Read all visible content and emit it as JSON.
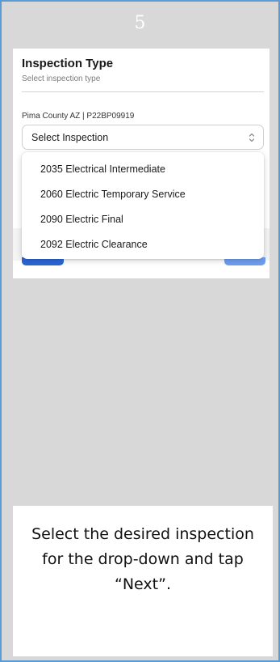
{
  "step": {
    "number": "5"
  },
  "form": {
    "title": "Inspection Type",
    "subtitle": "Select inspection type",
    "permit_label": "Pima County AZ | P22BP09919",
    "select": {
      "value": "Select Inspection",
      "icon": "chevron-up-down-icon"
    }
  },
  "dropdown": {
    "options": [
      "2035 Electrical Intermediate",
      "2060 Electric Temporary Service",
      "2090 Electric Final",
      "2092 Electric Clearance"
    ]
  },
  "instruction": {
    "text": "Select the desired inspection for the drop-down and tap “Next”."
  },
  "colors": {
    "frame_border": "#5b9bd5",
    "background": "#d8d8d8",
    "primary_button": "#2b66d6",
    "next_button": "#6f9ef0"
  }
}
